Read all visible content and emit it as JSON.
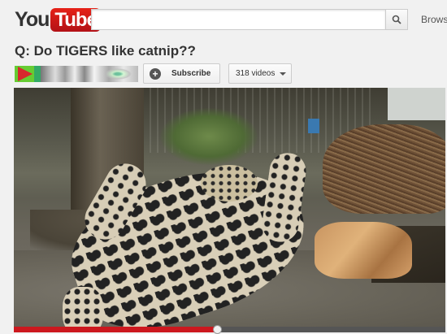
{
  "header": {
    "logo_you": "You",
    "logo_tube": "Tube",
    "search_placeholder": "",
    "search_icon": "search-icon",
    "browse_label": "Brows"
  },
  "video": {
    "title": "Q: Do TIGERS like catnip??",
    "progress_fraction": 0.47
  },
  "channel": {
    "subscribe_label": "Subscribe",
    "videos_label": "318 videos"
  },
  "colors": {
    "brand_red": "#cc181e",
    "text": "#333333"
  }
}
